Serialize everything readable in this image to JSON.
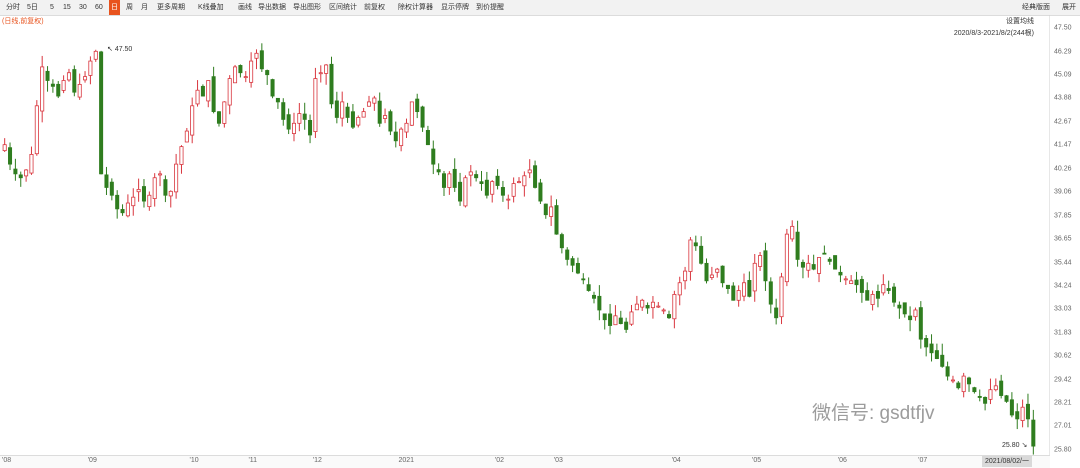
{
  "toolbar": {
    "items": [
      "分时",
      "5日",
      "5",
      "15",
      "30",
      "60",
      "日",
      "周",
      "月",
      "更多周期",
      "K线叠加",
      "画线",
      "导出数据",
      "导出图形",
      "区间统计",
      "前复权",
      "除权计算器",
      "显示停牌",
      "到价提醒"
    ],
    "active": "日",
    "right_items": [
      "经典版面",
      "展开"
    ]
  },
  "mode_label": "(日线,前复权)",
  "ma_setting": "设置均线",
  "date_range": "2020/8/3-2021/8/2(244根)",
  "watermark": "微信号: gsdtfjv",
  "high_label": "47.50",
  "low_label": "25.80",
  "cursor_date": "2021/08/02/一",
  "colors": {
    "up": "#d9363e",
    "down": "#2f7d1f",
    "active_tab": "#e8531e"
  },
  "chart_data": {
    "type": "candlestick",
    "title": "",
    "xlabel": "",
    "ylabel": "",
    "ylim": [
      25.0,
      48.0
    ],
    "y_ticks": [
      "47.50",
      "46.29",
      "45.09",
      "43.88",
      "42.67",
      "41.47",
      "40.26",
      "39.06",
      "37.85",
      "36.65",
      "35.44",
      "34.24",
      "33.03",
      "31.83",
      "30.62",
      "29.42",
      "28.21",
      "27.01",
      "25.80"
    ],
    "x_ticks": [
      "'08",
      "'09",
      "'10",
      "'11",
      "'12",
      "2021",
      "'02",
      "'03",
      "'04",
      "'05",
      "'06",
      "'07"
    ],
    "max": {
      "value": 47.5,
      "month": "'09"
    },
    "min": {
      "value": 25.8,
      "month": "'07"
    },
    "close_path": [
      {
        "m": "'08",
        "v": [
          41.5,
          40.5,
          40.0,
          39.8,
          40.2,
          41.0,
          43.5,
          45.5,
          44.8,
          44.5,
          44.0,
          44.8,
          45.2,
          44.2,
          44.6,
          45.0
        ]
      },
      {
        "m": "'09",
        "v": [
          45.8,
          46.3,
          40.0,
          39.3,
          38.9,
          38.2,
          38.0,
          38.5,
          38.8,
          39.2,
          38.6,
          38.9,
          39.8,
          40.0,
          38.9,
          39.1,
          40.5,
          41.4,
          42.2
        ]
      },
      {
        "m": "'10",
        "v": [
          43.5,
          44.3,
          44.0,
          44.8,
          43.2,
          42.6,
          43.7,
          44.9,
          45.5,
          45.2,
          45.0
        ]
      },
      {
        "m": "'11",
        "v": [
          45.8,
          46.2,
          45.4,
          45.1,
          44.0,
          43.7,
          42.8,
          42.3,
          42.6,
          43.1,
          42.8,
          42.0
        ]
      },
      {
        "m": "'12",
        "v": [
          44.9,
          45.2,
          45.6,
          43.6,
          42.9,
          43.7,
          42.9,
          42.4,
          42.9,
          43.2,
          43.7,
          43.9,
          42.6,
          43.0,
          42.2,
          41.7
        ]
      },
      {
        "m": "2021",
        "v": [
          42.3,
          42.6,
          43.7,
          43.2,
          42.4,
          41.5,
          40.5,
          40.1,
          39.3,
          40.0,
          39.3,
          38.6,
          39.8,
          40.1,
          39.8,
          39.5,
          38.9,
          39.6
        ]
      },
      {
        "m": "'02",
        "v": [
          39.4,
          38.9,
          38.7,
          39.5,
          39.6,
          39.9,
          40.2,
          39.3,
          38.6,
          37.9,
          38.3
        ]
      },
      {
        "m": "'03",
        "v": [
          36.9,
          36.2,
          35.6,
          35.3,
          34.9,
          34.6,
          34.0,
          33.6,
          33.0,
          32.5,
          32.2,
          32.7,
          32.3,
          32.0,
          32.9,
          33.3,
          33.5,
          33.1,
          33.4,
          33.2,
          33.0,
          32.6
        ]
      },
      {
        "m": "'04",
        "v": [
          33.8,
          34.4,
          35.0,
          36.6,
          36.3,
          35.4,
          34.5,
          34.8,
          35.1,
          34.4,
          34.1,
          33.5,
          34.0,
          34.4,
          33.7
        ]
      },
      {
        "m": "'05",
        "v": [
          35.4,
          35.8,
          34.5,
          33.3,
          32.6,
          34.7,
          36.9,
          37.3,
          35.6,
          35.2,
          35.4,
          35.1,
          35.7,
          35.9,
          35.5,
          35.1
        ]
      },
      {
        "m": "'06",
        "v": [
          34.8,
          34.6,
          34.5,
          34.3,
          33.9,
          33.5,
          33.8,
          33.6,
          34.3,
          34.0,
          33.4,
          33.1,
          32.8,
          32.5,
          33.0
        ]
      },
      {
        "m": "'07",
        "v": [
          31.5,
          31.1,
          30.8,
          30.5,
          30.1,
          29.6,
          29.4,
          29.0,
          29.6,
          29.2,
          28.8,
          28.5,
          28.2,
          28.9,
          29.1,
          28.6,
          28.3,
          27.6,
          27.4,
          28.0,
          27.4,
          26.0
        ]
      }
    ]
  }
}
